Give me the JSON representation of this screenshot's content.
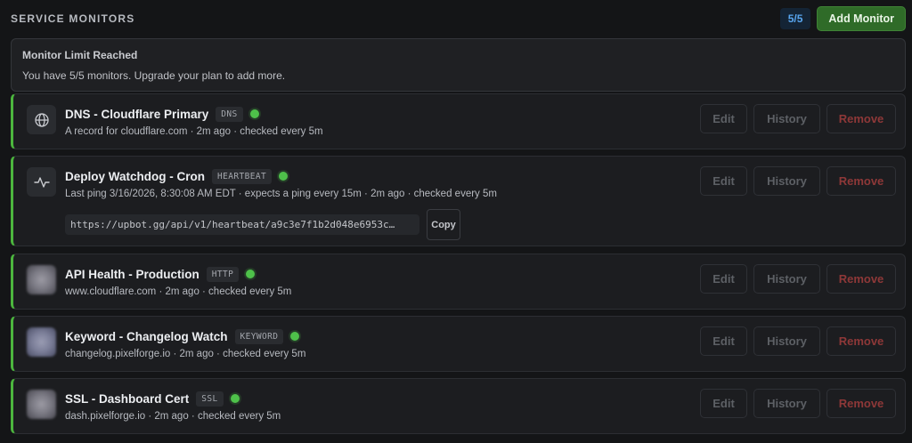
{
  "header": {
    "title": "SERVICE MONITORS",
    "count_badge": "5/5",
    "add_button": "Add Monitor"
  },
  "limit_banner": {
    "title": "Monitor Limit Reached",
    "message": "You have 5/5 monitors. Upgrade your plan to add more."
  },
  "actions": {
    "edit": "Edit",
    "history": "History",
    "remove": "Remove"
  },
  "status_color": "#4ec14a",
  "accent_green": "#2f6b28",
  "monitors": [
    {
      "name": "DNS - Cloudflare Primary",
      "tag": "DNS",
      "status": "up",
      "icon": "globe-icon",
      "subtitle": "A record for cloudflare.com · 2m ago · checked every 5m"
    },
    {
      "name": "Deploy Watchdog - Cron",
      "tag": "HEARTBEAT",
      "status": "up",
      "icon": "pulse-icon",
      "subtitle": "Last ping 3/16/2026, 8:30:08 AM EDT · expects a ping every 15m · 2m ago · checked every 5m",
      "heartbeat_url": "https://upbot.gg/api/v1/heartbeat/a9c3e7f1b2d048e6953c…",
      "copy_label": "Copy"
    },
    {
      "name": "API Health - Production",
      "tag": "HTTP",
      "status": "up",
      "icon": "favicon",
      "subtitle": "www.cloudflare.com · 2m ago · checked every 5m"
    },
    {
      "name": "Keyword - Changelog Watch",
      "tag": "KEYWORD",
      "status": "up",
      "icon": "favicon",
      "subtitle": "changelog.pixelforge.io · 2m ago · checked every 5m"
    },
    {
      "name": "SSL - Dashboard Cert",
      "tag": "SSL",
      "status": "up",
      "icon": "favicon",
      "subtitle": "dash.pixelforge.io · 2m ago · checked every 5m"
    }
  ]
}
